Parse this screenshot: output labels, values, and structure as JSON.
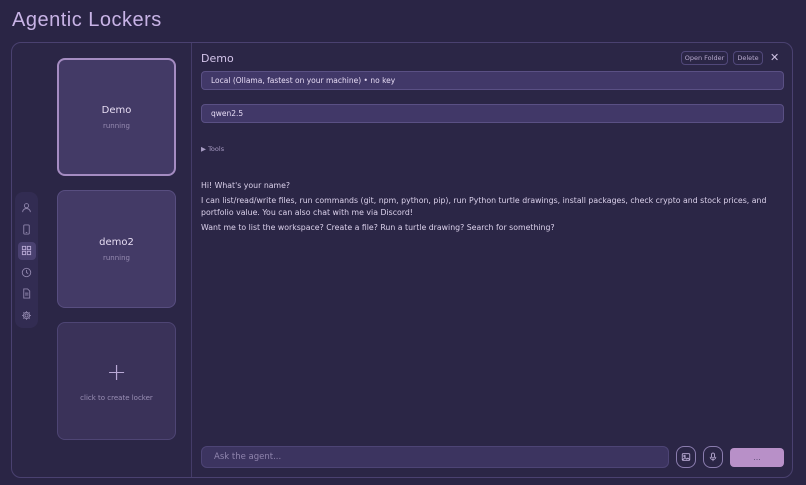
{
  "app": {
    "title": "Agentic Lockers"
  },
  "rail": {
    "items": [
      {
        "icon": "user-icon",
        "active": false
      },
      {
        "icon": "phone-icon",
        "active": false
      },
      {
        "icon": "grid-icon",
        "active": true
      },
      {
        "icon": "clock-icon",
        "active": false
      },
      {
        "icon": "document-icon",
        "active": false
      },
      {
        "icon": "gear-icon",
        "active": false
      }
    ]
  },
  "lockers": [
    {
      "name": "Demo",
      "status": "running",
      "selected": true
    },
    {
      "name": "demo2",
      "status": "running",
      "selected": false
    }
  ],
  "create_locker": {
    "icon": "+",
    "label": "click to create locker"
  },
  "panel": {
    "title": "Demo",
    "open_folder_label": "Open Folder",
    "delete_label": "Delete",
    "close_icon": "✕",
    "provider_value": "Local (Ollama, fastest on your machine) • no key",
    "model_value": "qwen2.5",
    "tools_label": "▶ Tools"
  },
  "chat": {
    "messages": [
      "Hi! What's your name?",
      "I can list/read/write files, run commands (git, npm, python, pip), run Python turtle drawings, install packages, check crypto and stock prices, and portfolio value. You can also chat with me via Discord!",
      "Want me to list the workspace? Create a file? Run a turtle drawing? Search for something?"
    ]
  },
  "composer": {
    "placeholder": "Ask the agent...",
    "send_label": "..."
  },
  "colors": {
    "accent": "#b890c8",
    "background": "#2a2545",
    "card": "#433a66"
  }
}
